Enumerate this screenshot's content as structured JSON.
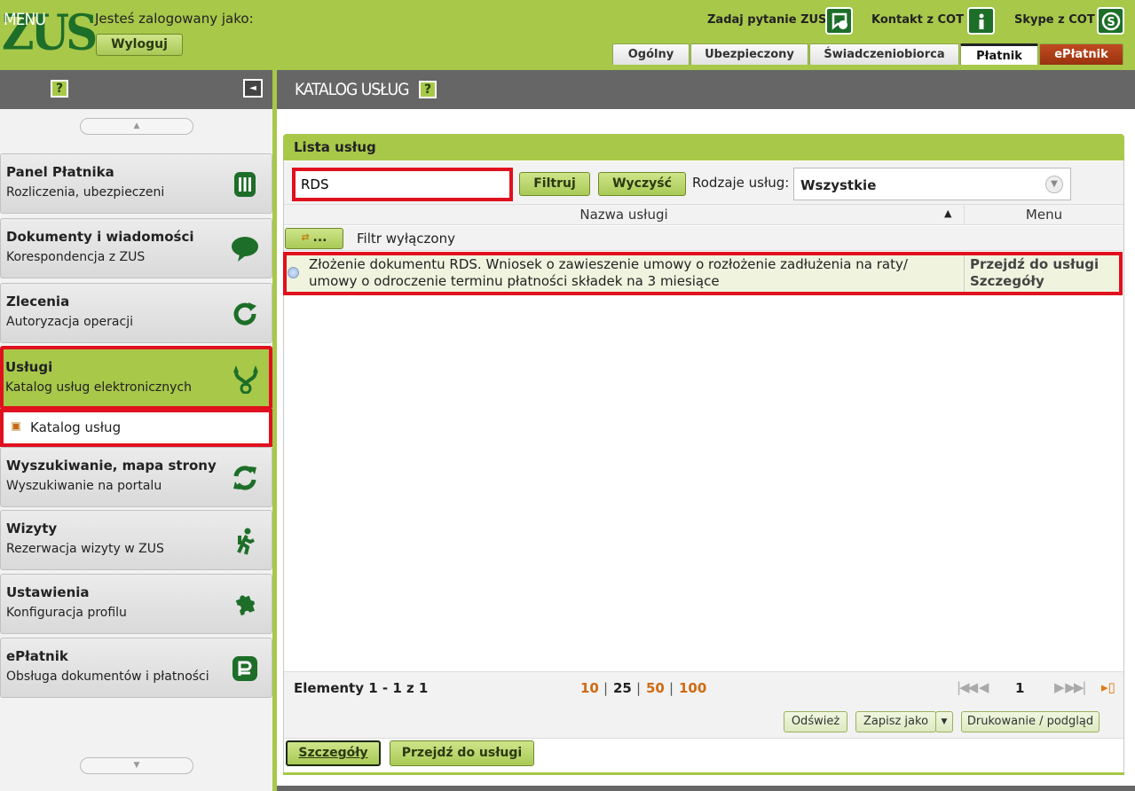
{
  "header": {
    "logo": "ZUS",
    "logged_in_label": "Jesteś zalogowany jako:",
    "logout": "Wyloguj",
    "links": [
      {
        "label": "Zadaj pytanie ZUS",
        "icon": "chat-question-icon"
      },
      {
        "label": "Kontakt z COT",
        "icon": "info-icon"
      },
      {
        "label": "Skype z COT",
        "icon": "skype-icon"
      }
    ],
    "tabs": [
      "Ogólny",
      "Ubezpieczony",
      "Świadczeniobiorca",
      "Płatnik",
      "ePłatnik"
    ],
    "active_tab": "Płatnik"
  },
  "menu": {
    "title": "MENU",
    "help": "?",
    "collapse_icon": "◄",
    "scroll_up": "▲",
    "scroll_down": "▼",
    "items": [
      {
        "title": "Panel Płatnika",
        "subtitle": "Rozliczenia, ubezpieczeni",
        "icon": "panel-icon"
      },
      {
        "title": "Dokumenty i wiadomości",
        "subtitle": "Korespondencja z ZUS",
        "icon": "speech-bubble-icon"
      },
      {
        "title": "Zlecenia",
        "subtitle": "Autoryzacja operacji",
        "icon": "refresh-icon"
      },
      {
        "title": "Usługi",
        "subtitle": "Katalog usług elektronicznych",
        "icon": "services-icon"
      },
      {
        "title": "Wyszukiwanie, mapa strony",
        "subtitle": "Wyszukiwanie na portalu",
        "icon": "sync-icon"
      },
      {
        "title": "Wizyty",
        "subtitle": "Rezerwacja wizyty w ZUS",
        "icon": "walking-person-icon"
      },
      {
        "title": "Ustawienia",
        "subtitle": "Konfiguracja profilu",
        "icon": "puzzle-icon"
      },
      {
        "title": "ePłatnik",
        "subtitle": "Obsługa dokumentów i płatności",
        "icon": "epayer-icon"
      }
    ],
    "sub_item": "Katalog usług"
  },
  "catalog": {
    "title": "KATALOG USŁUG",
    "help": "?",
    "list_title": "Lista usług",
    "search_value": "RDS",
    "filter_button": "Filtruj",
    "clear_button": "Wyczyść",
    "types_label": "Rodzaje usług:",
    "types_value": "Wszystkie",
    "col_name": "Nazwa usługi",
    "col_menu": "Menu",
    "filter_btn": "...",
    "filter_status": "Filtr wyłączony",
    "rows": [
      {
        "name": "Złożenie dokumentu RDS. Wniosek o zawieszenie umowy o rozłożenie zadłużenia na raty/ umowy o odroczenie terminu płatności składek na 3 miesiące",
        "link1": "Przejdź do usługi",
        "link2": "Szczegóły"
      }
    ],
    "elements": "Elementy 1 - 1 z 1",
    "page_sizes": [
      "10",
      "25",
      "50",
      "100"
    ],
    "page": "1",
    "refresh": "Odśwież",
    "save_as": "Zapisz jako",
    "print": "Drukowanie / podgląd",
    "details": "Szczegóły",
    "go_to_service": "Przejdź do usługi"
  }
}
